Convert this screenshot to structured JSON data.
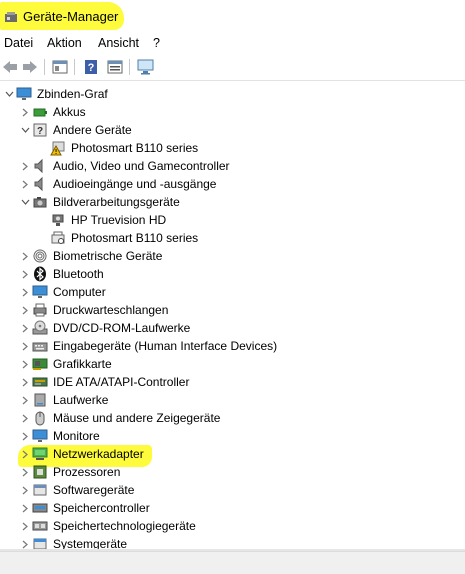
{
  "window": {
    "title": "Geräte-Manager"
  },
  "menu": [
    "Datei",
    "Aktion",
    "Ansicht",
    "?"
  ],
  "toolbar": {
    "buttons": [
      "back-icon",
      "forward-icon",
      "properties-icon",
      "help-icon",
      "view-icon",
      "monitor-scan-icon"
    ]
  },
  "tree": {
    "root": "Zbinden-Graf",
    "items": [
      {
        "label": "Akkus",
        "icon": "battery-icon"
      },
      {
        "label": "Andere Geräte",
        "icon": "unknown-device-icon"
      },
      {
        "label": "Photosmart B110 series",
        "icon": "warning-device-icon"
      },
      {
        "label": "Audio, Video und Gamecontroller",
        "icon": "speaker-icon"
      },
      {
        "label": "Audioeingänge und -ausgänge",
        "icon": "speaker-icon"
      },
      {
        "label": "Bildverarbeitungsgeräte",
        "icon": "camera-icon"
      },
      {
        "label": "HP Truevision HD",
        "icon": "webcam-icon"
      },
      {
        "label": "Photosmart B110 series",
        "icon": "scanner-icon"
      },
      {
        "label": "Biometrische Geräte",
        "icon": "fingerprint-icon"
      },
      {
        "label": "Bluetooth",
        "icon": "bluetooth-icon"
      },
      {
        "label": "Computer",
        "icon": "computer-icon"
      },
      {
        "label": "Druckwarteschlangen",
        "icon": "printer-icon"
      },
      {
        "label": "DVD/CD-ROM-Laufwerke",
        "icon": "disc-icon"
      },
      {
        "label": "Eingabegeräte (Human Interface Devices)",
        "icon": "keyboard-icon"
      },
      {
        "label": "Grafikkarte",
        "icon": "graphics-card-icon"
      },
      {
        "label": "IDE ATA/ATAPI-Controller",
        "icon": "controller-icon"
      },
      {
        "label": "Laufwerke",
        "icon": "drive-icon"
      },
      {
        "label": "Mäuse und andere Zeigegeräte",
        "icon": "mouse-icon"
      },
      {
        "label": "Monitore",
        "icon": "monitor-icon"
      },
      {
        "label": "Netzwerkadapter",
        "icon": "network-adapter-icon"
      },
      {
        "label": "Prozessoren",
        "icon": "processor-icon"
      },
      {
        "label": "Softwaregeräte",
        "icon": "software-device-icon"
      },
      {
        "label": "Speichercontroller",
        "icon": "storage-controller-icon"
      },
      {
        "label": "Speichertechnologiegeräte",
        "icon": "storage-tech-icon"
      },
      {
        "label": "Systemgeräte",
        "icon": "system-device-icon"
      }
    ]
  },
  "colors": {
    "highlight": "#fdfb3c"
  }
}
